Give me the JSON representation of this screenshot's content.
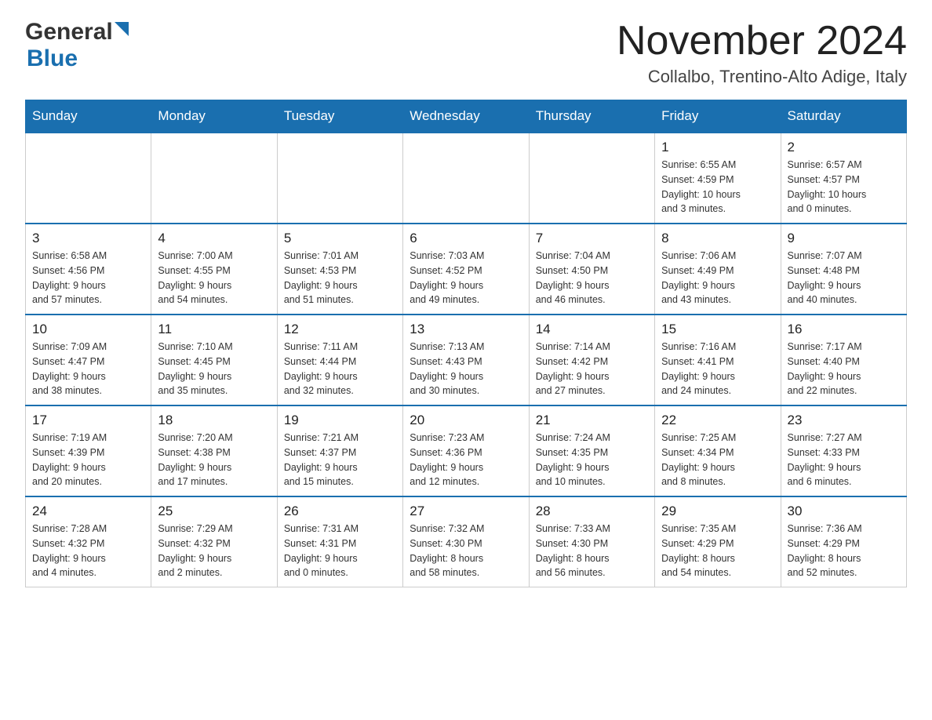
{
  "header": {
    "logo_general": "General",
    "logo_blue": "Blue",
    "month": "November 2024",
    "location": "Collalbo, Trentino-Alto Adige, Italy"
  },
  "weekdays": [
    "Sunday",
    "Monday",
    "Tuesday",
    "Wednesday",
    "Thursday",
    "Friday",
    "Saturday"
  ],
  "weeks": [
    [
      {
        "day": "",
        "info": ""
      },
      {
        "day": "",
        "info": ""
      },
      {
        "day": "",
        "info": ""
      },
      {
        "day": "",
        "info": ""
      },
      {
        "day": "",
        "info": ""
      },
      {
        "day": "1",
        "info": "Sunrise: 6:55 AM\nSunset: 4:59 PM\nDaylight: 10 hours\nand 3 minutes."
      },
      {
        "day": "2",
        "info": "Sunrise: 6:57 AM\nSunset: 4:57 PM\nDaylight: 10 hours\nand 0 minutes."
      }
    ],
    [
      {
        "day": "3",
        "info": "Sunrise: 6:58 AM\nSunset: 4:56 PM\nDaylight: 9 hours\nand 57 minutes."
      },
      {
        "day": "4",
        "info": "Sunrise: 7:00 AM\nSunset: 4:55 PM\nDaylight: 9 hours\nand 54 minutes."
      },
      {
        "day": "5",
        "info": "Sunrise: 7:01 AM\nSunset: 4:53 PM\nDaylight: 9 hours\nand 51 minutes."
      },
      {
        "day": "6",
        "info": "Sunrise: 7:03 AM\nSunset: 4:52 PM\nDaylight: 9 hours\nand 49 minutes."
      },
      {
        "day": "7",
        "info": "Sunrise: 7:04 AM\nSunset: 4:50 PM\nDaylight: 9 hours\nand 46 minutes."
      },
      {
        "day": "8",
        "info": "Sunrise: 7:06 AM\nSunset: 4:49 PM\nDaylight: 9 hours\nand 43 minutes."
      },
      {
        "day": "9",
        "info": "Sunrise: 7:07 AM\nSunset: 4:48 PM\nDaylight: 9 hours\nand 40 minutes."
      }
    ],
    [
      {
        "day": "10",
        "info": "Sunrise: 7:09 AM\nSunset: 4:47 PM\nDaylight: 9 hours\nand 38 minutes."
      },
      {
        "day": "11",
        "info": "Sunrise: 7:10 AM\nSunset: 4:45 PM\nDaylight: 9 hours\nand 35 minutes."
      },
      {
        "day": "12",
        "info": "Sunrise: 7:11 AM\nSunset: 4:44 PM\nDaylight: 9 hours\nand 32 minutes."
      },
      {
        "day": "13",
        "info": "Sunrise: 7:13 AM\nSunset: 4:43 PM\nDaylight: 9 hours\nand 30 minutes."
      },
      {
        "day": "14",
        "info": "Sunrise: 7:14 AM\nSunset: 4:42 PM\nDaylight: 9 hours\nand 27 minutes."
      },
      {
        "day": "15",
        "info": "Sunrise: 7:16 AM\nSunset: 4:41 PM\nDaylight: 9 hours\nand 24 minutes."
      },
      {
        "day": "16",
        "info": "Sunrise: 7:17 AM\nSunset: 4:40 PM\nDaylight: 9 hours\nand 22 minutes."
      }
    ],
    [
      {
        "day": "17",
        "info": "Sunrise: 7:19 AM\nSunset: 4:39 PM\nDaylight: 9 hours\nand 20 minutes."
      },
      {
        "day": "18",
        "info": "Sunrise: 7:20 AM\nSunset: 4:38 PM\nDaylight: 9 hours\nand 17 minutes."
      },
      {
        "day": "19",
        "info": "Sunrise: 7:21 AM\nSunset: 4:37 PM\nDaylight: 9 hours\nand 15 minutes."
      },
      {
        "day": "20",
        "info": "Sunrise: 7:23 AM\nSunset: 4:36 PM\nDaylight: 9 hours\nand 12 minutes."
      },
      {
        "day": "21",
        "info": "Sunrise: 7:24 AM\nSunset: 4:35 PM\nDaylight: 9 hours\nand 10 minutes."
      },
      {
        "day": "22",
        "info": "Sunrise: 7:25 AM\nSunset: 4:34 PM\nDaylight: 9 hours\nand 8 minutes."
      },
      {
        "day": "23",
        "info": "Sunrise: 7:27 AM\nSunset: 4:33 PM\nDaylight: 9 hours\nand 6 minutes."
      }
    ],
    [
      {
        "day": "24",
        "info": "Sunrise: 7:28 AM\nSunset: 4:32 PM\nDaylight: 9 hours\nand 4 minutes."
      },
      {
        "day": "25",
        "info": "Sunrise: 7:29 AM\nSunset: 4:32 PM\nDaylight: 9 hours\nand 2 minutes."
      },
      {
        "day": "26",
        "info": "Sunrise: 7:31 AM\nSunset: 4:31 PM\nDaylight: 9 hours\nand 0 minutes."
      },
      {
        "day": "27",
        "info": "Sunrise: 7:32 AM\nSunset: 4:30 PM\nDaylight: 8 hours\nand 58 minutes."
      },
      {
        "day": "28",
        "info": "Sunrise: 7:33 AM\nSunset: 4:30 PM\nDaylight: 8 hours\nand 56 minutes."
      },
      {
        "day": "29",
        "info": "Sunrise: 7:35 AM\nSunset: 4:29 PM\nDaylight: 8 hours\nand 54 minutes."
      },
      {
        "day": "30",
        "info": "Sunrise: 7:36 AM\nSunset: 4:29 PM\nDaylight: 8 hours\nand 52 minutes."
      }
    ]
  ]
}
